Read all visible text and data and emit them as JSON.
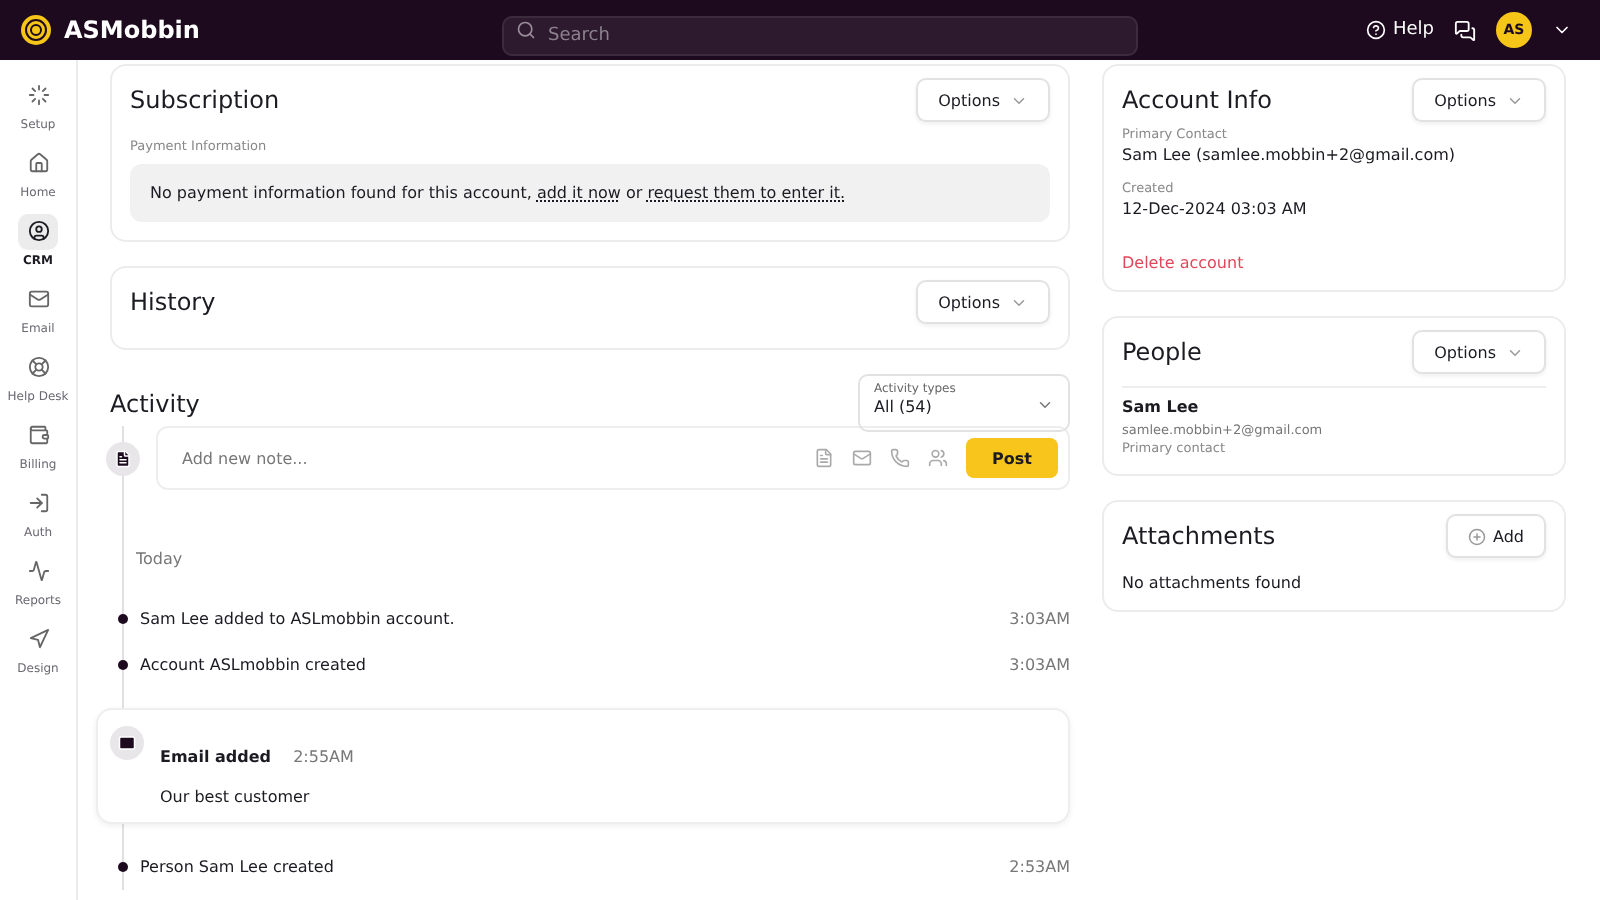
{
  "header": {
    "brand": "ASMobbin",
    "search": {
      "placeholder": "Search"
    },
    "help": "Help",
    "avatar": "AS"
  },
  "sidebar": {
    "items": [
      {
        "label": "Setup",
        "selected": false
      },
      {
        "label": "Home",
        "selected": false
      },
      {
        "label": "CRM",
        "selected": true
      },
      {
        "label": "Email",
        "selected": false
      },
      {
        "label": "Help Desk",
        "selected": false
      },
      {
        "label": "Billing",
        "selected": false
      },
      {
        "label": "Auth",
        "selected": false
      },
      {
        "label": "Reports",
        "selected": false
      },
      {
        "label": "Design",
        "selected": false
      }
    ]
  },
  "subscription": {
    "title": "Subscription",
    "options": "Options",
    "payment_label": "Payment Information",
    "notice_start": "No payment information found for this account,",
    "link_1": "add it now",
    "notice_mid": "or",
    "link_2": "request them to enter it."
  },
  "history": {
    "title": "History",
    "options": "Options"
  },
  "activity": {
    "title": "Activity",
    "filter": {
      "label": "Activity types",
      "value": "All (54)"
    },
    "note_placeholder": "Add new note...",
    "post": "Post",
    "group": "Today",
    "events": [
      {
        "kind": "event",
        "text": "Sam Lee added to ASLmobbin account.",
        "time": "3:03AM"
      },
      {
        "kind": "event",
        "text": "Account ASLmobbin created",
        "time": "3:03AM"
      },
      {
        "kind": "email",
        "title": "Email added",
        "time": "2:55AM",
        "body": "Our best customer"
      },
      {
        "kind": "event",
        "text": "Person Sam Lee created",
        "time": "2:53AM"
      }
    ]
  },
  "account_info": {
    "title": "Account Info",
    "options": "Options",
    "primary_label": "Primary Contact",
    "primary_value": "Sam Lee (samlee.mobbin+2@gmail.com)",
    "created_label": "Created",
    "created_value": "12-Dec-2024 03:03 AM",
    "delete": "Delete account"
  },
  "people": {
    "title": "People",
    "options": "Options",
    "name": "Sam Lee",
    "email": "samlee.mobbin+2@gmail.com",
    "role": "Primary contact"
  },
  "attachments": {
    "title": "Attachments",
    "add": "Add",
    "empty": "No attachments found"
  }
}
